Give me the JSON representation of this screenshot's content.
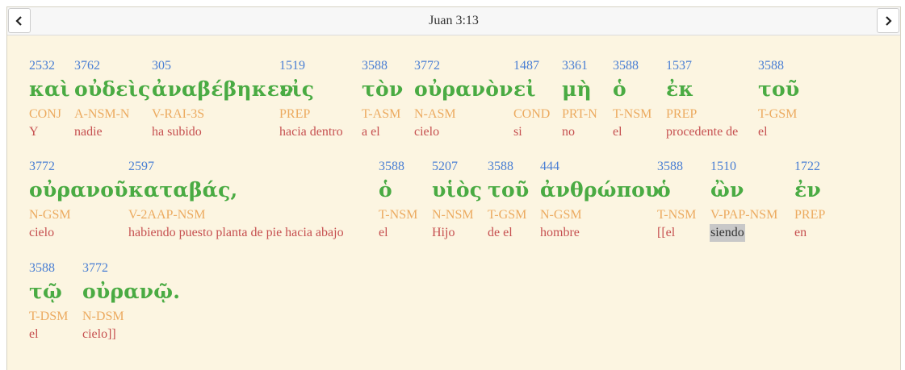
{
  "header": {
    "title": "Juan 3:13",
    "prev_icon": "chevron-left-icon",
    "next_icon": "chevron-right-icon"
  },
  "colors": {
    "strongs": "#4a7fd4",
    "greek": "#4aab43",
    "parsing": "#ecaa5f",
    "gloss": "#c65050",
    "background": "#fcf5e1"
  },
  "words": [
    {
      "strongs": "2532",
      "greek": "καὶ",
      "parsing": "CONJ",
      "gloss": "Y"
    },
    {
      "strongs": "3762",
      "greek": "οὐδεὶς",
      "parsing": "A-NSM-N",
      "gloss": "nadie"
    },
    {
      "strongs": "305",
      "greek": "ἀναβέβηκεν",
      "parsing": "V-RAI-3S",
      "gloss": "ha subido"
    },
    {
      "strongs": "1519",
      "greek": "εἰς",
      "parsing": "PREP",
      "gloss": "hacia dentro"
    },
    {
      "strongs": "3588",
      "greek": "τὸν",
      "parsing": "T-ASM",
      "gloss": "a el"
    },
    {
      "strongs": "3772",
      "greek": "οὐρανὸν",
      "parsing": "N-ASM",
      "gloss": "cielo"
    },
    {
      "strongs": "1487",
      "greek": "εἰ",
      "parsing": "COND",
      "gloss": "si"
    },
    {
      "strongs": "3361",
      "greek": "μὴ",
      "parsing": "PRT-N",
      "gloss": "no"
    },
    {
      "strongs": "3588",
      "greek": "ὁ",
      "parsing": "T-NSM",
      "gloss": "el"
    },
    {
      "strongs": "1537",
      "greek": "ἐκ",
      "parsing": "PREP",
      "gloss": "procedente de"
    },
    {
      "strongs": "3588",
      "greek": "τοῦ",
      "parsing": "T-GSM",
      "gloss": "el"
    },
    {
      "strongs": "3772",
      "greek": "οὐρανοῦ",
      "parsing": "N-GSM",
      "gloss": "cielo"
    },
    {
      "strongs": "2597",
      "greek": "καταβάς,",
      "parsing": "V-2AAP-NSM",
      "gloss": "habiendo puesto planta de pie hacia abajo"
    },
    {
      "strongs": "3588",
      "greek": "ὁ",
      "parsing": "T-NSM",
      "gloss": "el"
    },
    {
      "strongs": "5207",
      "greek": "υἱὸς",
      "parsing": "N-NSM",
      "gloss": "Hijo"
    },
    {
      "strongs": "3588",
      "greek": "τοῦ",
      "parsing": "T-GSM",
      "gloss": "de el"
    },
    {
      "strongs": "444",
      "greek": "ἀνθρώπου",
      "parsing": "N-GSM",
      "gloss": "hombre"
    },
    {
      "strongs": "3588",
      "greek": "ὁ",
      "parsing": "T-NSM",
      "gloss": "[[el"
    },
    {
      "strongs": "1510",
      "greek": "ὢν",
      "parsing": "V-PAP-NSM",
      "gloss": "siendo",
      "selected": true
    },
    {
      "strongs": "1722",
      "greek": "ἐν",
      "parsing": "PREP",
      "gloss": "en"
    },
    {
      "strongs": "3588",
      "greek": "τῷ",
      "parsing": "T-DSM",
      "gloss": "el"
    },
    {
      "strongs": "3772",
      "greek": "οὐρανῷ.",
      "parsing": "N-DSM",
      "gloss": "cielo]]"
    }
  ]
}
